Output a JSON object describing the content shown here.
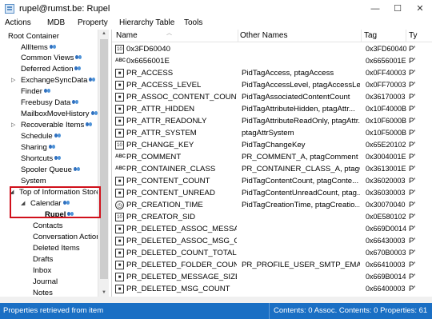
{
  "window": {
    "title": "rupel@rumst.be: Rupel",
    "minimize": "—",
    "maximize": "☐",
    "close": "✕"
  },
  "menu": {
    "items": [
      "Actions",
      "MDB",
      "Property",
      "Hierarchy Table",
      "Tools"
    ]
  },
  "tree": {
    "root": "Root Container",
    "items": [
      {
        "label": "AllItems"
      },
      {
        "label": "Common Views"
      },
      {
        "label": "Deferred Action"
      },
      {
        "label": "ExchangeSyncData"
      },
      {
        "label": "Finder"
      },
      {
        "label": "Freebusy Data"
      },
      {
        "label": "MailboxMoveHistory"
      },
      {
        "label": "Recoverable Items"
      },
      {
        "label": "Schedule"
      },
      {
        "label": "Sharing"
      },
      {
        "label": "Shortcuts"
      },
      {
        "label": "Spooler Queue"
      },
      {
        "label": "System"
      },
      {
        "label": "Top of Information Store"
      },
      {
        "label": "Calendar"
      },
      {
        "label": "Rupel"
      },
      {
        "label": "Contacts"
      },
      {
        "label": "Conversation Actions"
      },
      {
        "label": "Deleted Items"
      },
      {
        "label": "Drafts"
      },
      {
        "label": "Inbox"
      },
      {
        "label": "Journal"
      },
      {
        "label": "Notes"
      }
    ]
  },
  "list": {
    "columns": [
      "Name",
      "Other Names",
      "Tag",
      "Ty"
    ],
    "rows": [
      {
        "icon": "binary",
        "name": "0x3FD60040",
        "other": "",
        "tag": "0x3FD60040",
        "ty": "P'"
      },
      {
        "icon": "abc",
        "name": "0x6656001E",
        "other": "",
        "tag": "0x6656001E",
        "ty": "P'"
      },
      {
        "icon": "box",
        "name": "PR_ACCESS",
        "other": "PidTagAccess, ptagAccess",
        "tag": "0x0FF40003",
        "ty": "P'"
      },
      {
        "icon": "box",
        "name": "PR_ACCESS_LEVEL",
        "other": "PidTagAccessLevel, ptagAccessLe...",
        "tag": "0x0FF70003",
        "ty": "P'"
      },
      {
        "icon": "box",
        "name": "PR_ASSOC_CONTENT_COUNT",
        "other": "PidTagAssociatedContentCount",
        "tag": "0x36170003",
        "ty": "P'"
      },
      {
        "icon": "box",
        "name": "PR_ATTR_HIDDEN",
        "other": "PidTagAttributeHidden, ptagAttr...",
        "tag": "0x10F4000B",
        "ty": "P'"
      },
      {
        "icon": "box",
        "name": "PR_ATTR_READONLY",
        "other": "PidTagAttributeReadOnly, ptagAttr...",
        "tag": "0x10F6000B",
        "ty": "P'"
      },
      {
        "icon": "box",
        "name": "PR_ATTR_SYSTEM",
        "other": "ptagAttrSystem",
        "tag": "0x10F5000B",
        "ty": "P'"
      },
      {
        "icon": "binary",
        "name": "PR_CHANGE_KEY",
        "other": "PidTagChangeKey",
        "tag": "0x65E20102",
        "ty": "P'"
      },
      {
        "icon": "abc",
        "name": "PR_COMMENT",
        "other": "PR_COMMENT_A, ptagComment",
        "tag": "0x3004001E",
        "ty": "P'"
      },
      {
        "icon": "abc",
        "name": "PR_CONTAINER_CLASS",
        "other": "PR_CONTAINER_CLASS_A, ptagCo...",
        "tag": "0x3613001E",
        "ty": "P'"
      },
      {
        "icon": "box",
        "name": "PR_CONTENT_COUNT",
        "other": "PidTagContentCount, ptagConte...",
        "tag": "0x36020003",
        "ty": "P'"
      },
      {
        "icon": "box",
        "name": "PR_CONTENT_UNREAD",
        "other": "PidTagContentUnreadCount, ptag...",
        "tag": "0x36030003",
        "ty": "P'"
      },
      {
        "icon": "clock",
        "name": "PR_CREATION_TIME",
        "other": "PidTagCreationTime, ptagCreatio...",
        "tag": "0x30070040",
        "ty": "P'"
      },
      {
        "icon": "binary",
        "name": "PR_CREATOR_SID",
        "other": "",
        "tag": "0x0E580102",
        "ty": "P'"
      },
      {
        "icon": "box",
        "name": "PR_DELETED_ASSOC_MESSAGE...",
        "other": "",
        "tag": "0x669D0014",
        "ty": "P'"
      },
      {
        "icon": "box",
        "name": "PR_DELETED_ASSOC_MSG_CO...",
        "other": "",
        "tag": "0x66430003",
        "ty": "P'"
      },
      {
        "icon": "box",
        "name": "PR_DELETED_COUNT_TOTAL",
        "other": "",
        "tag": "0x670B0003",
        "ty": "P'"
      },
      {
        "icon": "box",
        "name": "PR_DELETED_FOLDER_COUNT",
        "other": "PR_PROFILE_USER_SMTP_EMAIL_...",
        "tag": "0x66410003",
        "ty": "P'"
      },
      {
        "icon": "box",
        "name": "PR_DELETED_MESSAGE_SIZE_EX...",
        "other": "",
        "tag": "0x669B0014",
        "ty": "P'"
      },
      {
        "icon": "box",
        "name": "PR_DELETED_MSG_COUNT",
        "other": "",
        "tag": "0x66400003",
        "ty": "P'"
      }
    ]
  },
  "status": {
    "left": "Properties retrieved from item",
    "right": "Contents: 0 Assoc. Contents: 0   Properties: 61"
  },
  "colors": {
    "statusbar": "#1a6fc4",
    "highlight": "#d0101b"
  }
}
